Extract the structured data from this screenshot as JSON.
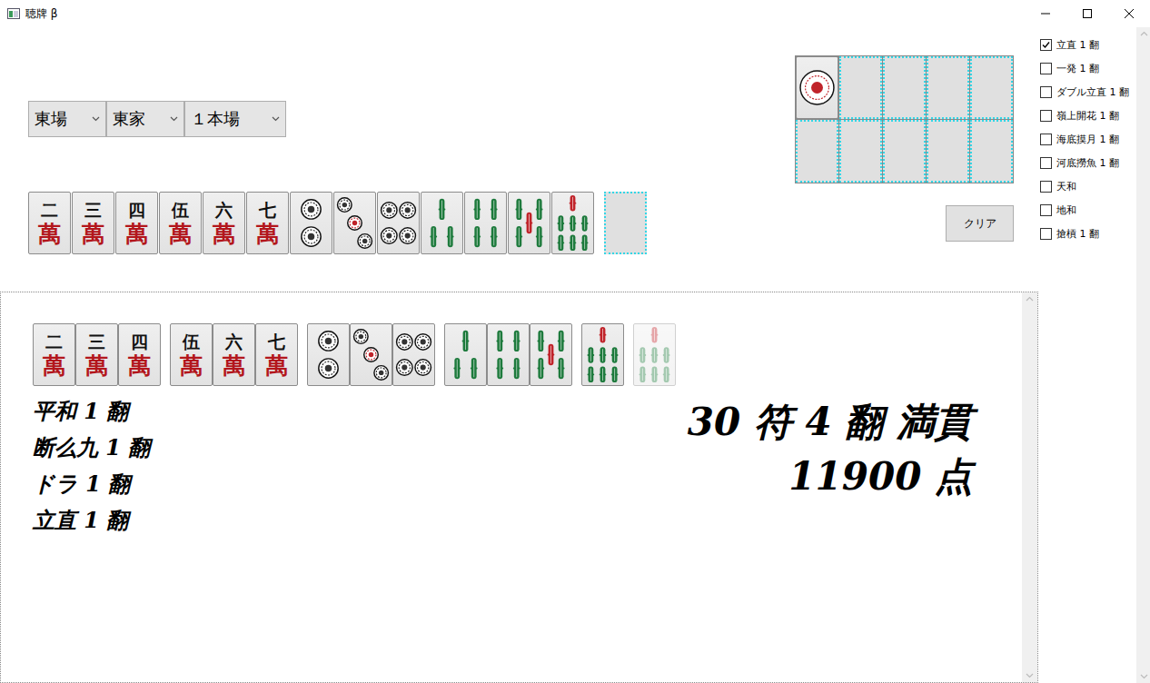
{
  "window": {
    "title": "聴牌 β"
  },
  "settings": [
    {
      "label": "東場"
    },
    {
      "label": "東家"
    },
    {
      "label": "１本場"
    }
  ],
  "hand": [
    {
      "kind": "man",
      "number": "二",
      "mark": "萬"
    },
    {
      "kind": "man",
      "number": "三",
      "mark": "萬"
    },
    {
      "kind": "man",
      "number": "四",
      "mark": "萬"
    },
    {
      "kind": "man",
      "number": "伍",
      "mark": "萬"
    },
    {
      "kind": "man",
      "number": "六",
      "mark": "萬"
    },
    {
      "kind": "man",
      "number": "七",
      "mark": "萬"
    },
    {
      "kind": "pin",
      "pips": 2
    },
    {
      "kind": "pin",
      "pips": 3
    },
    {
      "kind": "pin",
      "pips": 4
    },
    {
      "kind": "sou",
      "pips": 3
    },
    {
      "kind": "sou",
      "pips": 4
    },
    {
      "kind": "sou",
      "pips": 5
    },
    {
      "kind": "sou",
      "pips": 7
    },
    {
      "kind": "slot"
    }
  ],
  "dora": [
    {
      "kind": "pin",
      "pips": 1
    },
    {
      "kind": "slot"
    },
    {
      "kind": "slot"
    },
    {
      "kind": "slot"
    },
    {
      "kind": "slot"
    },
    {
      "kind": "slot"
    },
    {
      "kind": "slot"
    },
    {
      "kind": "slot"
    },
    {
      "kind": "slot"
    },
    {
      "kind": "slot"
    }
  ],
  "clear_button": "クリア",
  "options": [
    {
      "label": "立直",
      "han": "1 翻",
      "checked": true
    },
    {
      "label": "一発",
      "han": "1 翻",
      "checked": false
    },
    {
      "label": "ダブル立直",
      "han": "1 翻",
      "checked": false
    },
    {
      "label": "嶺上開花",
      "han": "1 翻",
      "checked": false
    },
    {
      "label": "海底摸月",
      "han": "1 翻",
      "checked": false
    },
    {
      "label": "河底撈魚",
      "han": "1 翻",
      "checked": false
    },
    {
      "label": "天和",
      "han": "",
      "checked": false
    },
    {
      "label": "地和",
      "han": "",
      "checked": false
    },
    {
      "label": "搶槓",
      "han": "1 翻",
      "checked": false
    }
  ],
  "result": {
    "groups": [
      [
        {
          "kind": "man",
          "number": "二",
          "mark": "萬",
          "winning": false
        },
        {
          "kind": "man",
          "number": "三",
          "mark": "萬",
          "winning": false
        },
        {
          "kind": "man",
          "number": "四",
          "mark": "萬",
          "winning": false
        }
      ],
      [
        {
          "kind": "man",
          "number": "伍",
          "mark": "萬",
          "winning": false
        },
        {
          "kind": "man",
          "number": "六",
          "mark": "萬",
          "winning": false
        },
        {
          "kind": "man",
          "number": "七",
          "mark": "萬",
          "winning": false
        }
      ],
      [
        {
          "kind": "pin",
          "pips": 2,
          "winning": false
        },
        {
          "kind": "pin",
          "pips": 3,
          "winning": false
        },
        {
          "kind": "pin",
          "pips": 4,
          "winning": false
        }
      ],
      [
        {
          "kind": "sou",
          "pips": 3,
          "winning": false
        },
        {
          "kind": "sou",
          "pips": 4,
          "winning": false
        },
        {
          "kind": "sou",
          "pips": 5,
          "winning": false
        }
      ],
      [
        {
          "kind": "sou",
          "pips": 7,
          "winning": false
        }
      ],
      [
        {
          "kind": "sou",
          "pips": 7,
          "winning": true
        }
      ]
    ],
    "yaku": [
      {
        "name": "平和",
        "han": "1 翻"
      },
      {
        "name": "断么九",
        "han": "1 翻"
      },
      {
        "name": "ドラ",
        "han": "1 翻"
      },
      {
        "name": "立直",
        "han": "1 翻"
      }
    ],
    "headline": "30 符 4 翻 満貫",
    "points": "11900 点"
  }
}
